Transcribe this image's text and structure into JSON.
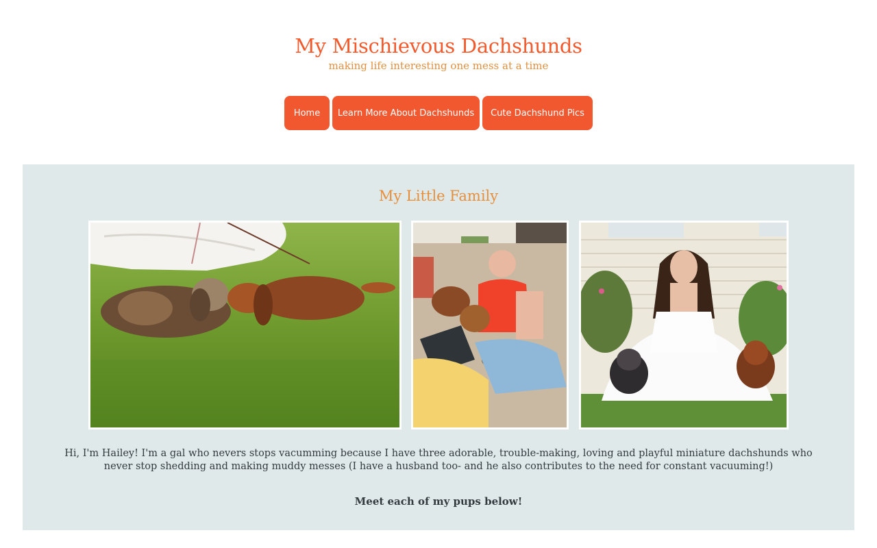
{
  "header": {
    "title": "My Mischievous Dachshunds",
    "tagline": "making life interesting one mess at a time"
  },
  "nav": {
    "items": [
      {
        "label": "Home"
      },
      {
        "label": "Learn More About Dachshunds"
      },
      {
        "label": "Cute Dachshund Pics"
      }
    ]
  },
  "family": {
    "heading": "My Little Family",
    "intro": "Hi, I'm Hailey! I'm a gal who nevers stops vacumming because I have three adorable, trouble-making, loving and playful miniature dachshunds who never stop shedding and making muddy messes (I have a husband too- and he also contributes to the need for constant vacuuming!)",
    "cta": "Meet each of my pups below!"
  },
  "colors": {
    "accent": "#f2582f",
    "title": "#f05a2c",
    "secondary": "#e58f3d",
    "panel": "#dfe9e9",
    "text": "#333a40"
  }
}
